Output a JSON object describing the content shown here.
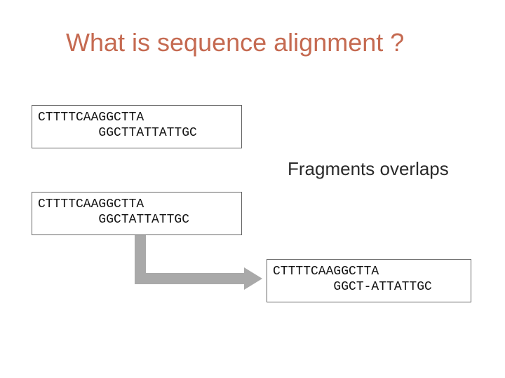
{
  "title": "What is sequence alignment ?",
  "overlap_label": "Fragments overlaps",
  "box1": {
    "line1": "CTTTTCAAGGCTTA",
    "line2": "        GGCTTATTATTGC"
  },
  "box2": {
    "line1": "CTTTTCAAGGCTTA",
    "line2": "        GGCTATTATTGC"
  },
  "box3": {
    "line1": "CTTTTCAAGGCTTA",
    "line2": "        GGCT-ATTATTGC"
  }
}
